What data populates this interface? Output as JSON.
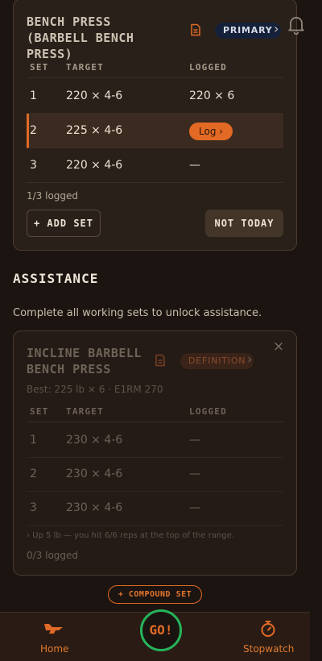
{
  "exercise1": {
    "title": "BENCH PRESS (BARBELL BENCH PRESS)",
    "badge": "PRIMARY",
    "chevron": "›",
    "headers": {
      "set": "SET",
      "target": "TARGET",
      "logged": "LOGGED"
    },
    "rows": [
      {
        "set": "1",
        "target": "220 × 4-6",
        "logged": "220 × 6"
      },
      {
        "set": "2",
        "target": "225 × 4-6",
        "logged": "Log ›"
      },
      {
        "set": "3",
        "target": "220 × 4-6",
        "logged": "—"
      }
    ],
    "progress": "1/3 logged",
    "add_set": "+ ADD SET",
    "not_today": "NOT TODAY"
  },
  "assistance": {
    "heading": "ASSISTANCE",
    "subtitle": "Complete all working sets to unlock assistance."
  },
  "exercise2": {
    "title": "INCLINE BARBELL BENCH PRESS",
    "badge": "DEFINITION",
    "chevron": "›",
    "close": "×",
    "best": "Best: 225 lb × 6 · E1RM 270",
    "headers": {
      "set": "SET",
      "target": "TARGET",
      "logged": "LOGGED"
    },
    "rows": [
      {
        "set": "1",
        "target": "230 × 4-6",
        "logged": "—"
      },
      {
        "set": "2",
        "target": "230 × 4-6",
        "logged": "—"
      },
      {
        "set": "3",
        "target": "230 × 4-6",
        "logged": "—"
      }
    ],
    "hint": "›  Up 5 lb — you hit 6/6 reps at the top of the range.",
    "progress": "0/3 logged"
  },
  "compound_set": "+ COMPOUND SET",
  "nav": {
    "home": "Home",
    "go": "GO!",
    "stopwatch": "Stopwatch"
  },
  "icons": {
    "bell": "bell-icon",
    "doc": "document-icon",
    "home": "home-icon",
    "stopwatch": "stopwatch-icon"
  },
  "colors": {
    "accent": "#e36a25",
    "go_ring": "#26b45a",
    "primary_badge": "#15213a"
  }
}
